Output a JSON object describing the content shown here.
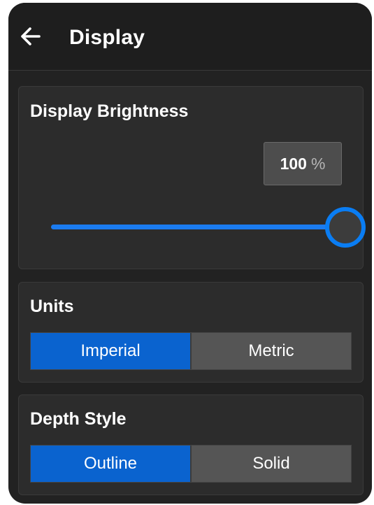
{
  "header": {
    "title": "Display",
    "back_icon": "arrow-left-icon"
  },
  "brightness": {
    "title": "Display Brightness",
    "value": "100",
    "unit": "%",
    "level_percent": 100,
    "accent_color": "#0a7df3"
  },
  "units": {
    "title": "Units",
    "options": [
      "Imperial",
      "Metric"
    ],
    "selected": "Imperial"
  },
  "depth_style": {
    "title": "Depth Style",
    "options": [
      "Outline",
      "Solid"
    ],
    "selected": "Outline"
  },
  "colors": {
    "background": "#222222",
    "card": "#2c2c2c",
    "selected_segment": "#0a63cf",
    "unselected_segment": "#555555"
  }
}
